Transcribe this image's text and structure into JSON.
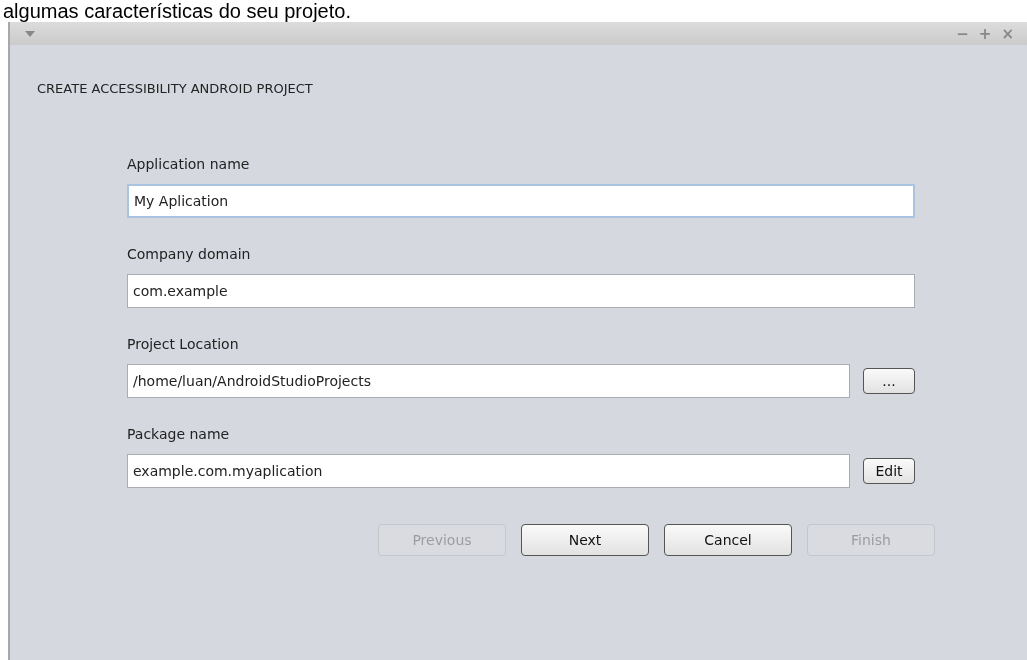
{
  "caption": "algumas características do seu projeto.",
  "window": {
    "controls": [
      "−",
      "+",
      "×"
    ]
  },
  "heading": "CREATE ACCESSIBILITY ANDROID PROJECT",
  "fields": [
    {
      "label": "Application name",
      "value": "My Aplication",
      "focused": true
    },
    {
      "label": "Company domain",
      "value": "com.example",
      "focused": false
    },
    {
      "label": "Project Location",
      "value": "/home/luan/AndroidStudioProjects",
      "focused": false,
      "button": "..."
    },
    {
      "label": "Package name",
      "value": "example.com.myaplication",
      "focused": false,
      "button": "Edit"
    }
  ],
  "buttons": [
    {
      "label": "Previous",
      "disabled": true
    },
    {
      "label": "Next",
      "disabled": false
    },
    {
      "label": "Cancel",
      "disabled": false
    },
    {
      "label": "Finish",
      "disabled": true
    }
  ]
}
